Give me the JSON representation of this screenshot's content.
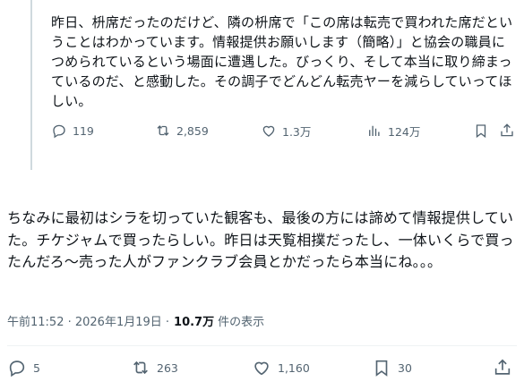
{
  "quoted_post": {
    "text": "昨日、枡席だったのだけど、隣の枡席で「この席は転売で買われた席だということはわかっています。情報提供お願いします（簡略）」と協会の職員につめられているという場面に遭遇した。びっくり、そして本当に取り締まっているのだ、と感動した。その調子でどんどん転売ヤーを減らしていってほしい。",
    "actions": {
      "reply_count": "119",
      "repost_count": "2,859",
      "like_count": "1.3万",
      "views_count": "124万"
    }
  },
  "post": {
    "text": "ちなみに最初はシラを切っていた観客も、最後の方には諦めて情報提供していた。チケジャムで買ったらしい。昨日は天覧相撲だったし、一体いくらで買ったんだろ〜売った人がファンクラブ会員とかだったら本当にね。。。",
    "timestamp": "午前11:52 · 2026年1月19日 ·",
    "views": "10.7万",
    "views_label": "件の表示",
    "actions": {
      "reply_count": "5",
      "repost_count": "263",
      "like_count": "1,160",
      "bookmark_count": "30"
    }
  },
  "icons": {
    "reply": "reply-icon",
    "repost": "repost-icon",
    "like": "heart-icon",
    "views": "analytics-icon",
    "bookmark": "bookmark-icon",
    "share": "share-icon"
  },
  "colors": {
    "text": "#0f1419",
    "secondary": "#536471",
    "divider": "#eff3f4",
    "thread_line": "#cfd9de"
  }
}
